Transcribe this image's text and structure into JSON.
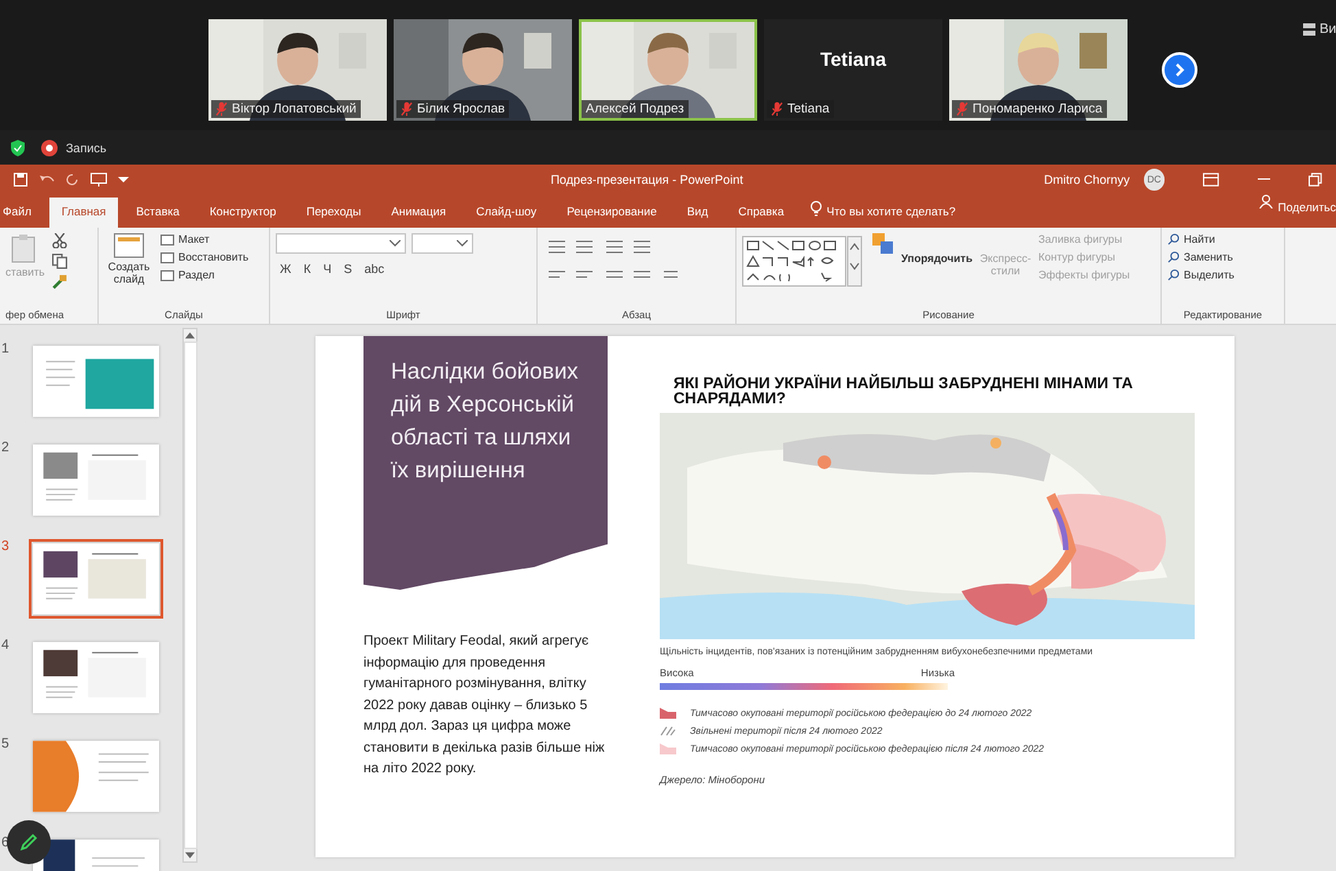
{
  "call": {
    "participants": [
      {
        "name": "Віктор Лопатовський",
        "muted": true,
        "video": true,
        "speaking": false
      },
      {
        "name": "Білик Ярослав",
        "muted": true,
        "video": true,
        "speaking": false
      },
      {
        "name": "Алексей Подрез",
        "muted": false,
        "video": true,
        "speaking": true
      },
      {
        "name": "Tetiana",
        "display_name": "Tetiana",
        "muted": true,
        "video": false,
        "speaking": false
      },
      {
        "name": "Пономаренко Лариса",
        "muted": true,
        "video": true,
        "speaking": false
      }
    ],
    "view_label": "Ви",
    "recording_label": "Запись"
  },
  "powerpoint": {
    "title": "Подрез-презентация - PowerPoint",
    "user": "Dmitro Chornyy",
    "user_initials": "DC",
    "tabs": [
      {
        "label": "Файл",
        "selected": false
      },
      {
        "label": "Главная",
        "selected": true
      },
      {
        "label": "Вставка",
        "selected": false
      },
      {
        "label": "Конструктор",
        "selected": false
      },
      {
        "label": "Переходы",
        "selected": false
      },
      {
        "label": "Анимация",
        "selected": false
      },
      {
        "label": "Слайд-шоу",
        "selected": false
      },
      {
        "label": "Рецензирование",
        "selected": false
      },
      {
        "label": "Вид",
        "selected": false
      },
      {
        "label": "Справка",
        "selected": false
      }
    ],
    "tell_me": "Что вы хотите сделать?",
    "share": "Поделитьс",
    "ribbon": {
      "clipboard": {
        "label": "фер обмена",
        "paste": {
          "label": "ставить",
          "disabled": true
        }
      },
      "slides": {
        "label": "Слайды",
        "new_slide": "Создать слайд",
        "items": [
          "Макет",
          "Восстановить",
          "Раздел"
        ]
      },
      "font": {
        "label": "Шрифт",
        "format": [
          "Ж",
          "К",
          "Ч",
          "S",
          "abc"
        ]
      },
      "paragraph": {
        "label": "Абзац"
      },
      "drawing": {
        "label": "Рисование",
        "arrange": "Упорядочить",
        "quick_styles": {
          "label": "Экспресс-стили",
          "disabled": true
        },
        "shape_items": [
          {
            "label": "Заливка фигуры",
            "disabled": true
          },
          {
            "label": "Контур фигуры",
            "disabled": true
          },
          {
            "label": "Эффекты фигуры",
            "disabled": true
          }
        ]
      },
      "editing": {
        "label": "Редактирование",
        "items": [
          "Найти",
          "Заменить",
          "Выделить"
        ]
      }
    },
    "thumbnails": [
      {
        "number": "1",
        "kind": "infographic",
        "selected": false
      },
      {
        "number": "2",
        "kind": "gray",
        "selected": false
      },
      {
        "number": "3",
        "kind": "purple",
        "selected": true
      },
      {
        "number": "4",
        "kind": "brown",
        "selected": false
      },
      {
        "number": "5",
        "kind": "orange",
        "selected": false
      },
      {
        "number": "6",
        "kind": "navy",
        "selected": false
      }
    ],
    "slide": {
      "title": "Наслідки бойових дій в Херсонській області та шляхи їх вирішення",
      "body": "Проект Military Feodal, який агрегує інформацію для проведення гуманітарного розмінування, влітку 2022 року давав оцінку – близько 5 млрд дол.  Зараз ця цифра може становити в декілька разів більше ніж на літо 2022 року.",
      "map_title": "ЯКІ РАЙОНИ УКРАЇНИ НАЙБІЛЬШ ЗАБРУДНЕНІ МІНАМИ ТА СНАРЯДАМИ?",
      "legend_title": "Щільність інцидентів, пов'язаних із потенційним забрудненням вибухонебезпечними предметами",
      "scale_high": "Висока",
      "scale_low": "Низька",
      "legend": [
        {
          "label": "Тимчасово окуповані території російською федерацією до 24 лютого 2022",
          "kind": "dark"
        },
        {
          "label": "Звільнені території після 24 лютого 2022",
          "kind": "hatched"
        },
        {
          "label": "Тимчасово окуповані території російською федерацією після 24 лютого 2022",
          "kind": "light"
        }
      ],
      "source": "Джерело: Міноборони"
    }
  }
}
